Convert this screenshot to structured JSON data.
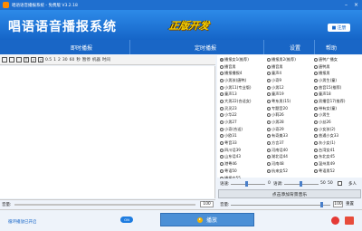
{
  "window": {
    "title": "唱语语音播报系统 - 免费版  V3.2.18"
  },
  "header": {
    "brand": "唱语语音播报系统",
    "badge": "正版开发",
    "register_label": "注册"
  },
  "menu": {
    "items": [
      "即时播报",
      "定时播报",
      "设置",
      "帮助"
    ]
  },
  "toolbar": {
    "items": [
      "0.5",
      "1",
      "2",
      "30",
      "60",
      "秒",
      "暂停",
      "机器",
      "时间"
    ]
  },
  "voices": [
    "播报女1(推荐)",
    "播报男2(推荐)",
    "唐鸭广播女",
    "播音男",
    "播音男",
    "唐鸭男",
    "播报播报4",
    "童声4",
    "播报男",
    "小男孩(唐鸭)",
    "小奇9",
    "小男生(童)",
    "小男11(专业版)",
    "小男12",
    "普音15(推荐)",
    "童声13",
    "童声19",
    "童声18",
    "大男22(合适女)",
    "粤东男(15)",
    "男播音17(推荐)",
    "灵灵23",
    "专题音20",
    "带有女(童)",
    "小华22",
    "小莉26",
    "小男生",
    "小男27",
    "小男28",
    "小丝26",
    "小奇(合适)",
    "小奇29",
    "小女孩(2)",
    "小欧31",
    "有奇美33",
    "普通小女33",
    "粤音33",
    "方言37",
    "灰小女(1)",
    "四川话39",
    "河南话40",
    "台湾女41",
    "山东话43",
    "湖北话44",
    "东北女45",
    "港粤46",
    "河南48",
    "温州男49",
    "粤语50",
    "杭来女52",
    "粤语男52",
    "播报女55"
  ],
  "selected_voice": 0,
  "controls": {
    "speed_label": "语速:",
    "speed_value": "0",
    "tone_label": "语调:",
    "tone_value": "50",
    "volume_right_label": "音量:",
    "volume_right_value": "50",
    "multi_label": "多人"
  },
  "bg_music_button": "点击添加背景音乐",
  "editor": {
    "volume_label": "音量:",
    "volume_value": "100"
  },
  "speed2": {
    "label": "音量:",
    "value": "100",
    "reset_label": "重置"
  },
  "bottom": {
    "loop_label": "循环播放已开启",
    "toggle_label": "ON",
    "play_label": "播放"
  }
}
